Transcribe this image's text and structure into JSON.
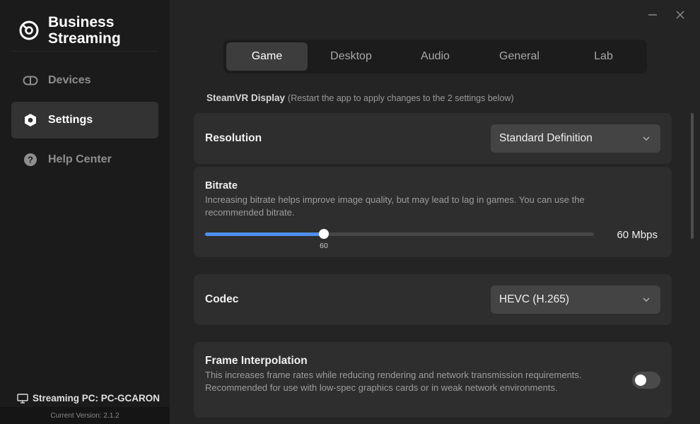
{
  "app": {
    "title": "Business Streaming",
    "brand_color": "#ffffff",
    "accent_color": "#4d90f0"
  },
  "window_controls": {
    "minimize_icon": "minimize-icon",
    "close_icon": "close-icon"
  },
  "sidebar": {
    "items": [
      {
        "label": "Devices",
        "icon": "devices-icon",
        "active": false
      },
      {
        "label": "Settings",
        "icon": "settings-icon",
        "active": true
      },
      {
        "label": "Help Center",
        "icon": "help-icon",
        "active": false
      }
    ],
    "device_label": "Streaming PC: PC-GCARON",
    "version": "Current Version: 2.1.2"
  },
  "tabs": [
    {
      "label": "Game",
      "active": true
    },
    {
      "label": "Desktop",
      "active": false
    },
    {
      "label": "Audio",
      "active": false
    },
    {
      "label": "General",
      "active": false
    },
    {
      "label": "Lab",
      "active": false
    }
  ],
  "section": {
    "title": "SteamVR Display",
    "note": "(Restart the app to apply changes to the 2 settings below)"
  },
  "settings": {
    "resolution": {
      "label": "Resolution",
      "value": "Standard Definition"
    },
    "bitrate": {
      "label": "Bitrate",
      "description": "Increasing bitrate helps improve image quality, but may lead to lag in games. You can use the recommended bitrate.",
      "slider_value": 60,
      "slider_max_fraction": 0.306,
      "tick_label": "60",
      "value_label": "60 Mbps"
    },
    "codec": {
      "label": "Codec",
      "value": "HEVC (H.265)"
    },
    "frame_interpolation": {
      "label": "Frame Interpolation",
      "description": "This increases frame rates while reducing rendering and network transmission requirements. Recommended for use with low-spec graphics cards or in weak network environments.",
      "enabled": false
    }
  }
}
